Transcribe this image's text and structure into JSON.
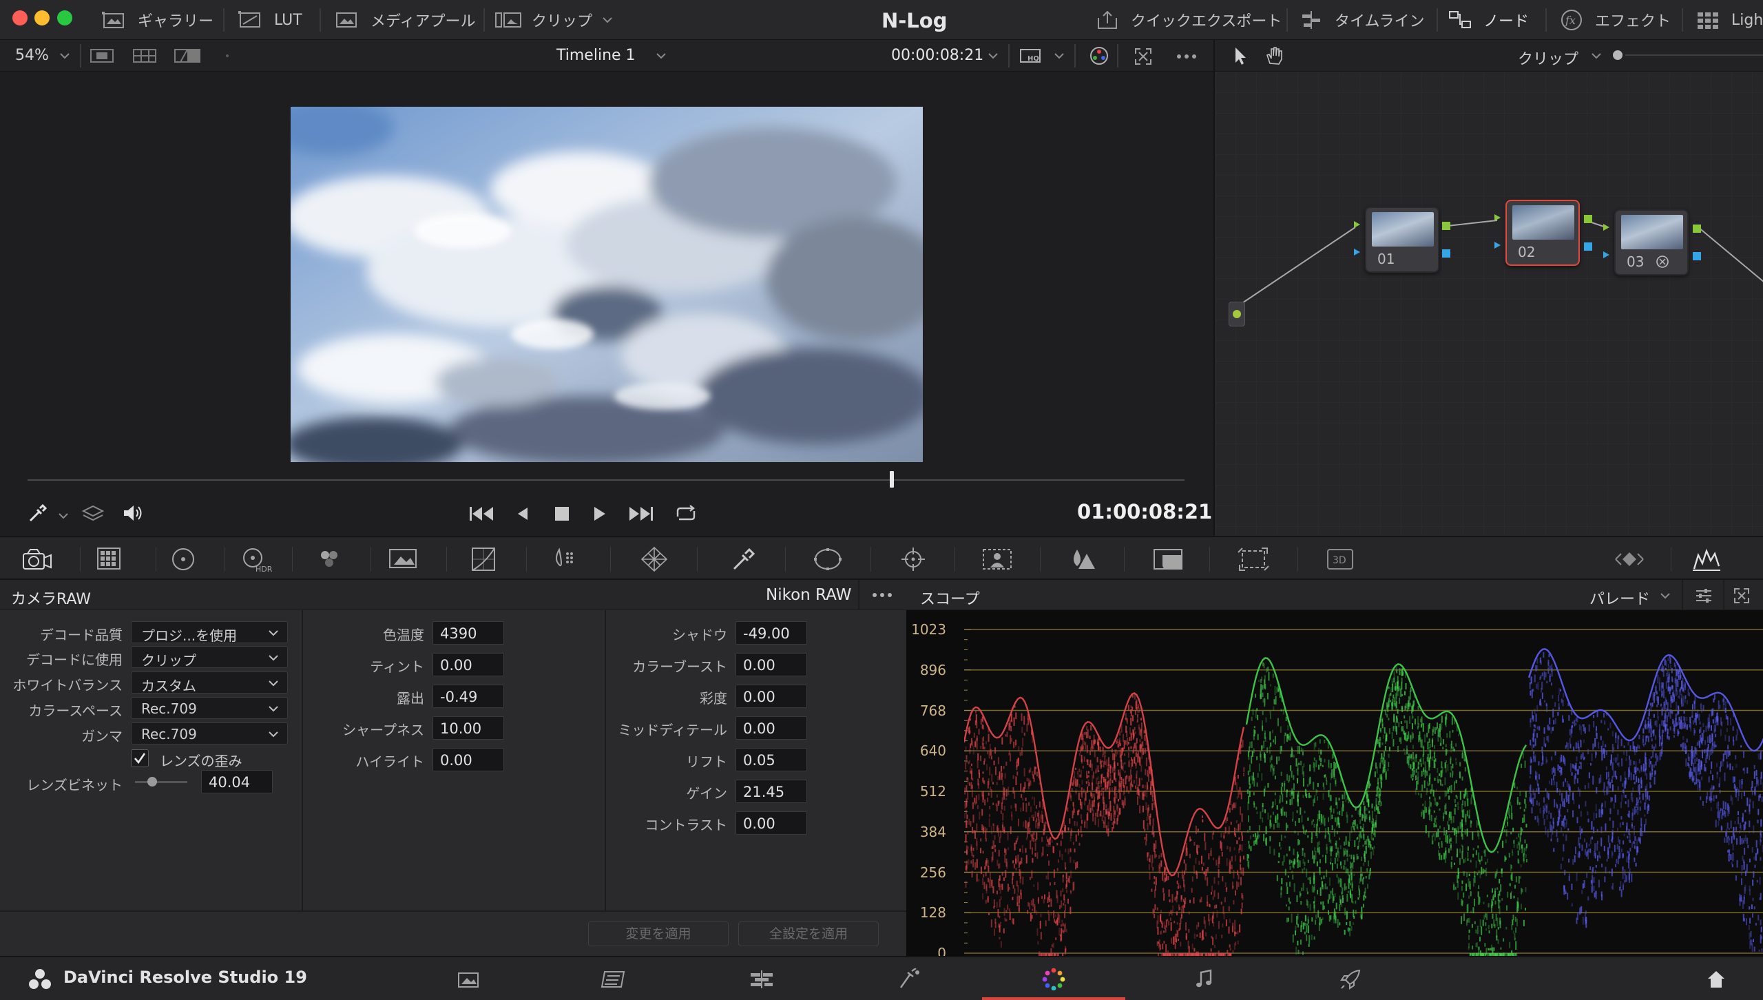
{
  "titlebar": {
    "title": "N-Log",
    "left_items": [
      {
        "label": "ギャラリー",
        "icon": "gallery-icon"
      },
      {
        "label": "LUT",
        "icon": "lut-icon"
      },
      {
        "label": "メディアプール",
        "icon": "media-pool-icon"
      },
      {
        "label": "クリップ",
        "icon": "clips-icon"
      }
    ],
    "right_items": [
      {
        "label": "クイックエクスポート",
        "icon": "quick-export-icon"
      },
      {
        "label": "タイムライン",
        "icon": "timeline-icon"
      },
      {
        "label": "ノード",
        "icon": "nodes-icon"
      },
      {
        "label": "エフェクト",
        "icon": "fx-icon"
      },
      {
        "label": "Ligh",
        "icon": "lightbox-icon"
      }
    ],
    "traffic_lights": [
      "#ff5f57",
      "#febc2e",
      "#28c840"
    ]
  },
  "viewerbar": {
    "zoom": "54%",
    "timeline_name": "Timeline 1",
    "source_timecode": "00:00:08:21",
    "node_mode": "クリップ"
  },
  "transport": {
    "timecode": "01:00:08:21",
    "playhead_progress": 0.747
  },
  "nodes": [
    {
      "label": "01",
      "selected": false
    },
    {
      "label": "02",
      "selected": true
    },
    {
      "label": "03",
      "selected": false
    }
  ],
  "rawpanel": {
    "title": "カメラRAW",
    "format": "Nikon RAW",
    "col1": {
      "rows": [
        {
          "label": "デコード品質",
          "value": "プロジ...を使用"
        },
        {
          "label": "デコードに使用",
          "value": "クリップ"
        },
        {
          "label": "ホワイトバランス",
          "value": "カスタム"
        },
        {
          "label": "カラースペース",
          "value": "Rec.709"
        },
        {
          "label": "ガンマ",
          "value": "Rec.709"
        }
      ],
      "lens_distortion_label": "レンズの歪み",
      "lens_distortion_checked": true,
      "vignette_label": "レンズビネット",
      "vignette_value": "40.04"
    },
    "col2": [
      {
        "label": "色温度",
        "value": "4390"
      },
      {
        "label": "ティント",
        "value": "0.00"
      },
      {
        "label": "露出",
        "value": "-0.49"
      },
      {
        "label": "シャープネス",
        "value": "10.00"
      },
      {
        "label": "ハイライト",
        "value": "0.00"
      }
    ],
    "col3": [
      {
        "label": "シャドウ",
        "value": "-49.00"
      },
      {
        "label": "カラーブースト",
        "value": "0.00"
      },
      {
        "label": "彩度",
        "value": "0.00"
      },
      {
        "label": "ミッドディテール",
        "value": "0.00"
      },
      {
        "label": "リフト",
        "value": "0.05"
      },
      {
        "label": "ゲイン",
        "value": "21.45"
      },
      {
        "label": "コントラスト",
        "value": "0.00"
      }
    ],
    "apply_changes": "変更を適用",
    "apply_all": "全設定を適用"
  },
  "scope": {
    "title": "スコープ",
    "mode": "パレード",
    "y_ticks": [
      "1023",
      "896",
      "768",
      "640",
      "512",
      "384",
      "256",
      "128",
      "0"
    ],
    "channel_colors": [
      "#e0444a",
      "#3fce4a",
      "#5a5cf0"
    ]
  },
  "bottom": {
    "app_name": "DaVinci Resolve Studio 19",
    "pages": [
      "media-page-icon",
      "cut-page-icon",
      "edit-page-icon",
      "fusion-page-icon",
      "color-page-icon",
      "fairlight-page-icon",
      "deliver-page-icon"
    ],
    "active_page": "color-page-icon"
  }
}
